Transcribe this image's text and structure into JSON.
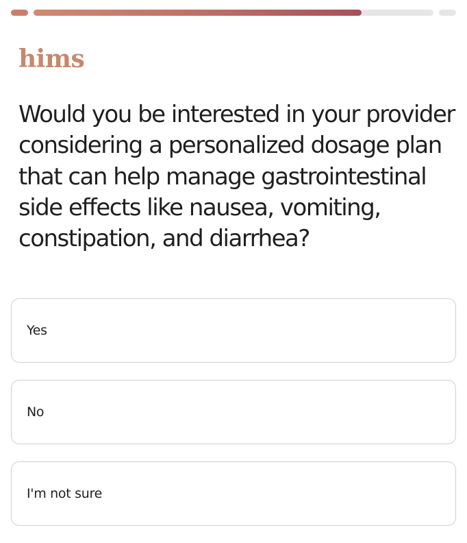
{
  "progress": {
    "segments": [
      {
        "fraction": 1.0
      },
      {
        "fraction": 0.82
      },
      {
        "fraction": 0.0
      }
    ]
  },
  "logo": {
    "text": "hims",
    "color": "#c8876b"
  },
  "question": {
    "text": "Would you be interested in your provider considering a personalized dosage plan that can help manage gastrointestinal side effects like nausea, vomiting, constipation, and diarrhea?"
  },
  "options": [
    {
      "label": "Yes"
    },
    {
      "label": "No"
    },
    {
      "label": "I'm not sure"
    }
  ],
  "colors": {
    "progress_start": "#d08a70",
    "progress_end": "#a94f59",
    "track": "#e6e6e6",
    "border": "#cfcfcf"
  }
}
